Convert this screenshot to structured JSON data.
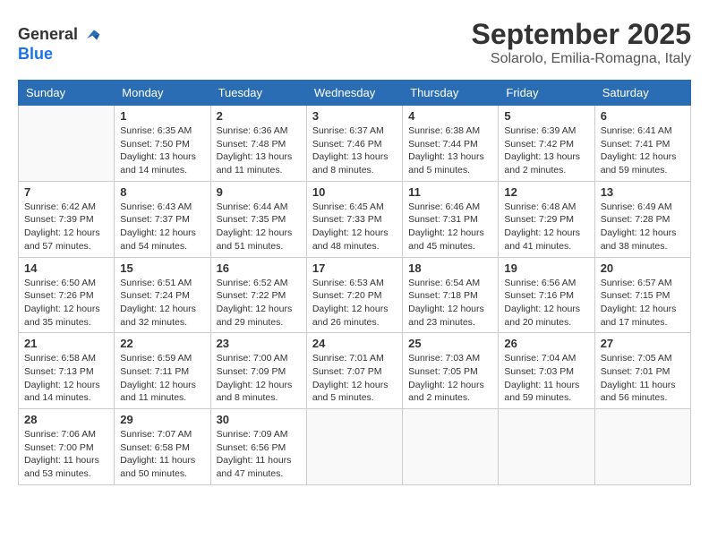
{
  "header": {
    "logo_general": "General",
    "logo_blue": "Blue",
    "month": "September 2025",
    "location": "Solarolo, Emilia-Romagna, Italy"
  },
  "weekdays": [
    "Sunday",
    "Monday",
    "Tuesday",
    "Wednesday",
    "Thursday",
    "Friday",
    "Saturday"
  ],
  "weeks": [
    [
      {
        "day": "",
        "info": ""
      },
      {
        "day": "1",
        "sunrise": "Sunrise: 6:35 AM",
        "sunset": "Sunset: 7:50 PM",
        "daylight": "Daylight: 13 hours and 14 minutes."
      },
      {
        "day": "2",
        "sunrise": "Sunrise: 6:36 AM",
        "sunset": "Sunset: 7:48 PM",
        "daylight": "Daylight: 13 hours and 11 minutes."
      },
      {
        "day": "3",
        "sunrise": "Sunrise: 6:37 AM",
        "sunset": "Sunset: 7:46 PM",
        "daylight": "Daylight: 13 hours and 8 minutes."
      },
      {
        "day": "4",
        "sunrise": "Sunrise: 6:38 AM",
        "sunset": "Sunset: 7:44 PM",
        "daylight": "Daylight: 13 hours and 5 minutes."
      },
      {
        "day": "5",
        "sunrise": "Sunrise: 6:39 AM",
        "sunset": "Sunset: 7:42 PM",
        "daylight": "Daylight: 13 hours and 2 minutes."
      },
      {
        "day": "6",
        "sunrise": "Sunrise: 6:41 AM",
        "sunset": "Sunset: 7:41 PM",
        "daylight": "Daylight: 12 hours and 59 minutes."
      }
    ],
    [
      {
        "day": "7",
        "sunrise": "Sunrise: 6:42 AM",
        "sunset": "Sunset: 7:39 PM",
        "daylight": "Daylight: 12 hours and 57 minutes."
      },
      {
        "day": "8",
        "sunrise": "Sunrise: 6:43 AM",
        "sunset": "Sunset: 7:37 PM",
        "daylight": "Daylight: 12 hours and 54 minutes."
      },
      {
        "day": "9",
        "sunrise": "Sunrise: 6:44 AM",
        "sunset": "Sunset: 7:35 PM",
        "daylight": "Daylight: 12 hours and 51 minutes."
      },
      {
        "day": "10",
        "sunrise": "Sunrise: 6:45 AM",
        "sunset": "Sunset: 7:33 PM",
        "daylight": "Daylight: 12 hours and 48 minutes."
      },
      {
        "day": "11",
        "sunrise": "Sunrise: 6:46 AM",
        "sunset": "Sunset: 7:31 PM",
        "daylight": "Daylight: 12 hours and 45 minutes."
      },
      {
        "day": "12",
        "sunrise": "Sunrise: 6:48 AM",
        "sunset": "Sunset: 7:29 PM",
        "daylight": "Daylight: 12 hours and 41 minutes."
      },
      {
        "day": "13",
        "sunrise": "Sunrise: 6:49 AM",
        "sunset": "Sunset: 7:28 PM",
        "daylight": "Daylight: 12 hours and 38 minutes."
      }
    ],
    [
      {
        "day": "14",
        "sunrise": "Sunrise: 6:50 AM",
        "sunset": "Sunset: 7:26 PM",
        "daylight": "Daylight: 12 hours and 35 minutes."
      },
      {
        "day": "15",
        "sunrise": "Sunrise: 6:51 AM",
        "sunset": "Sunset: 7:24 PM",
        "daylight": "Daylight: 12 hours and 32 minutes."
      },
      {
        "day": "16",
        "sunrise": "Sunrise: 6:52 AM",
        "sunset": "Sunset: 7:22 PM",
        "daylight": "Daylight: 12 hours and 29 minutes."
      },
      {
        "day": "17",
        "sunrise": "Sunrise: 6:53 AM",
        "sunset": "Sunset: 7:20 PM",
        "daylight": "Daylight: 12 hours and 26 minutes."
      },
      {
        "day": "18",
        "sunrise": "Sunrise: 6:54 AM",
        "sunset": "Sunset: 7:18 PM",
        "daylight": "Daylight: 12 hours and 23 minutes."
      },
      {
        "day": "19",
        "sunrise": "Sunrise: 6:56 AM",
        "sunset": "Sunset: 7:16 PM",
        "daylight": "Daylight: 12 hours and 20 minutes."
      },
      {
        "day": "20",
        "sunrise": "Sunrise: 6:57 AM",
        "sunset": "Sunset: 7:15 PM",
        "daylight": "Daylight: 12 hours and 17 minutes."
      }
    ],
    [
      {
        "day": "21",
        "sunrise": "Sunrise: 6:58 AM",
        "sunset": "Sunset: 7:13 PM",
        "daylight": "Daylight: 12 hours and 14 minutes."
      },
      {
        "day": "22",
        "sunrise": "Sunrise: 6:59 AM",
        "sunset": "Sunset: 7:11 PM",
        "daylight": "Daylight: 12 hours and 11 minutes."
      },
      {
        "day": "23",
        "sunrise": "Sunrise: 7:00 AM",
        "sunset": "Sunset: 7:09 PM",
        "daylight": "Daylight: 12 hours and 8 minutes."
      },
      {
        "day": "24",
        "sunrise": "Sunrise: 7:01 AM",
        "sunset": "Sunset: 7:07 PM",
        "daylight": "Daylight: 12 hours and 5 minutes."
      },
      {
        "day": "25",
        "sunrise": "Sunrise: 7:03 AM",
        "sunset": "Sunset: 7:05 PM",
        "daylight": "Daylight: 12 hours and 2 minutes."
      },
      {
        "day": "26",
        "sunrise": "Sunrise: 7:04 AM",
        "sunset": "Sunset: 7:03 PM",
        "daylight": "Daylight: 11 hours and 59 minutes."
      },
      {
        "day": "27",
        "sunrise": "Sunrise: 7:05 AM",
        "sunset": "Sunset: 7:01 PM",
        "daylight": "Daylight: 11 hours and 56 minutes."
      }
    ],
    [
      {
        "day": "28",
        "sunrise": "Sunrise: 7:06 AM",
        "sunset": "Sunset: 7:00 PM",
        "daylight": "Daylight: 11 hours and 53 minutes."
      },
      {
        "day": "29",
        "sunrise": "Sunrise: 7:07 AM",
        "sunset": "Sunset: 6:58 PM",
        "daylight": "Daylight: 11 hours and 50 minutes."
      },
      {
        "day": "30",
        "sunrise": "Sunrise: 7:09 AM",
        "sunset": "Sunset: 6:56 PM",
        "daylight": "Daylight: 11 hours and 47 minutes."
      },
      {
        "day": "",
        "info": ""
      },
      {
        "day": "",
        "info": ""
      },
      {
        "day": "",
        "info": ""
      },
      {
        "day": "",
        "info": ""
      }
    ]
  ]
}
